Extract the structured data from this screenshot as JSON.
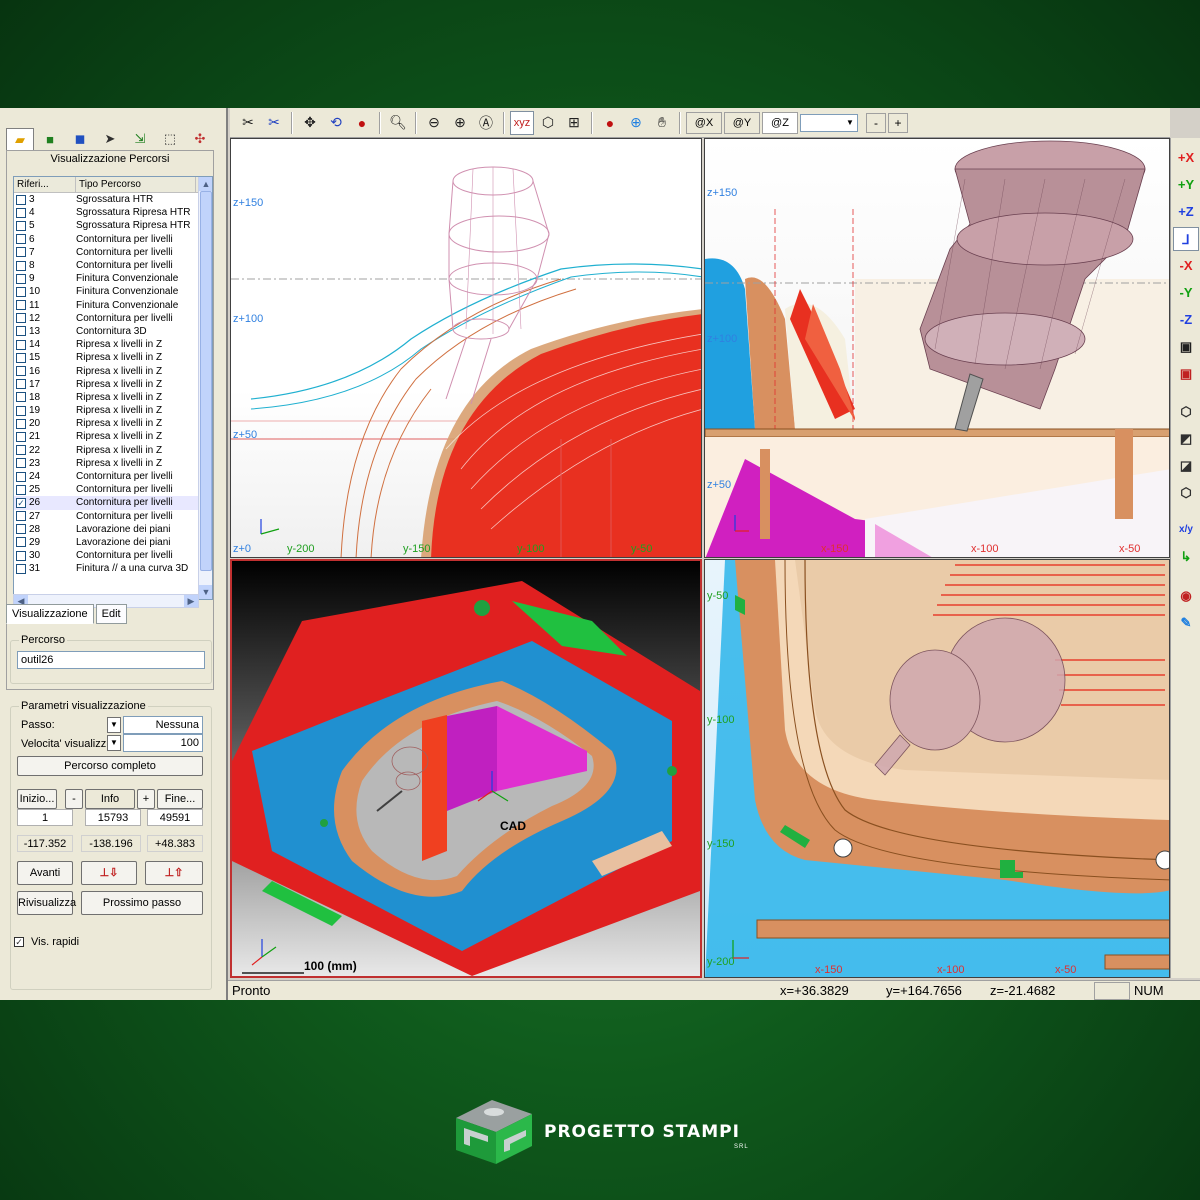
{
  "left_panel": {
    "title": "Visualizzazione Percorsi",
    "toolbar_icons": [
      "path-view-icon",
      "solid-icon",
      "cube-icon",
      "cursor-icon",
      "route-icon",
      "select-box-icon",
      "tool-color-icon"
    ],
    "list": {
      "columns": [
        "Riferi...",
        "Tipo Percorso"
      ],
      "rows": [
        {
          "ref": "3",
          "type": "Sgrossatura HTR",
          "checked": false
        },
        {
          "ref": "4",
          "type": "Sgrossatura Ripresa HTR",
          "checked": false
        },
        {
          "ref": "5",
          "type": "Sgrossatura Ripresa HTR",
          "checked": false
        },
        {
          "ref": "6",
          "type": "Contornitura per livelli",
          "checked": false
        },
        {
          "ref": "7",
          "type": "Contornitura per livelli",
          "checked": false
        },
        {
          "ref": "8",
          "type": "Contornitura per livelli",
          "checked": false
        },
        {
          "ref": "9",
          "type": "Finitura Convenzionale",
          "checked": false
        },
        {
          "ref": "10",
          "type": "Finitura Convenzionale",
          "checked": false
        },
        {
          "ref": "11",
          "type": "Finitura Convenzionale",
          "checked": false
        },
        {
          "ref": "12",
          "type": "Contornitura per livelli",
          "checked": false
        },
        {
          "ref": "13",
          "type": "Contornitura 3D",
          "checked": false
        },
        {
          "ref": "14",
          "type": "Ripresa x livelli in Z",
          "checked": false
        },
        {
          "ref": "15",
          "type": "Ripresa x livelli in Z",
          "checked": false
        },
        {
          "ref": "16",
          "type": "Ripresa x livelli in Z",
          "checked": false
        },
        {
          "ref": "17",
          "type": "Ripresa x livelli in Z",
          "checked": false
        },
        {
          "ref": "18",
          "type": "Ripresa x livelli in Z",
          "checked": false
        },
        {
          "ref": "19",
          "type": "Ripresa x livelli in Z",
          "checked": false
        },
        {
          "ref": "20",
          "type": "Ripresa x livelli in Z",
          "checked": false
        },
        {
          "ref": "21",
          "type": "Ripresa x livelli in Z",
          "checked": false
        },
        {
          "ref": "22",
          "type": "Ripresa x livelli in Z",
          "checked": false
        },
        {
          "ref": "23",
          "type": "Ripresa x livelli in Z",
          "checked": false
        },
        {
          "ref": "24",
          "type": "Contornitura per livelli",
          "checked": false
        },
        {
          "ref": "25",
          "type": "Contornitura per livelli",
          "checked": false
        },
        {
          "ref": "26",
          "type": "Contornitura per livelli",
          "checked": true
        },
        {
          "ref": "27",
          "type": "Contornitura per livelli",
          "checked": false
        },
        {
          "ref": "28",
          "type": "Lavorazione dei piani",
          "checked": false
        },
        {
          "ref": "29",
          "type": "Lavorazione dei piani",
          "checked": false
        },
        {
          "ref": "30",
          "type": "Contornitura per livelli",
          "checked": false
        },
        {
          "ref": "31",
          "type": "Finitura // a una curva 3D",
          "checked": false
        }
      ]
    },
    "tabs": [
      "Visualizzazione",
      "Edit"
    ],
    "percorso": {
      "label": "Percorso",
      "value": "outil26"
    },
    "params": {
      "label": "Parametri visualizzazione",
      "passo_label": "Passo:",
      "passo_value": "Nessuna",
      "velocita_label": "Velocita' visualizz",
      "velocita_value": "100",
      "percorso_completo": "Percorso completo"
    },
    "nav": {
      "inizio": "Inizio...",
      "minus": "-",
      "info": "Info",
      "plus": "+",
      "fine": "Fine...",
      "start_value": "1",
      "current_value": "15793",
      "end_value": "49591"
    },
    "coords": {
      "x": "-117.352",
      "y": "-138.196",
      "z": "+48.383"
    },
    "avanti": "Avanti",
    "rivisualizza": "Rivisualizza",
    "prossimo_passo": "Prossimo passo",
    "vis_rapidi": {
      "label": "Vis. rapidi",
      "checked": true
    }
  },
  "top_toolbar": {
    "view_buttons": [
      "@X",
      "@Y",
      "@Z"
    ],
    "active_view": "@Z",
    "zoom_minus": "-",
    "zoom_plus": "+"
  },
  "right_toolbar": {
    "axis_buttons": [
      "+X",
      "+Y",
      "+Z",
      "-X",
      "-Y",
      "-Z"
    ],
    "colors": {
      "x": "#e02020",
      "y": "#10a010",
      "z": "#2040e0"
    }
  },
  "viewports": {
    "top_left": {
      "labels": [
        "z+150",
        "z+100",
        "z+50",
        "z+0",
        "y-200",
        "y-150",
        "y-100",
        "y-50"
      ]
    },
    "top_right": {
      "labels": [
        "z+150",
        "z+100",
        "z+50",
        "x-150",
        "x-100",
        "x-50"
      ]
    },
    "bottom_left": {
      "cad_label": "CAD",
      "scale_label": "100 (mm)"
    },
    "bottom_right": {
      "labels": [
        "y-50",
        "y-100",
        "y-150",
        "y-200",
        "x-150",
        "x-100",
        "x-50"
      ]
    }
  },
  "status": {
    "text": "Pronto",
    "x": "x=+36.3829",
    "y": "y=+164.7656",
    "z": "z=-21.4682",
    "num": "NUM"
  },
  "logo": {
    "name": "PROGETTO STAMPI",
    "suffix": "SRL"
  }
}
